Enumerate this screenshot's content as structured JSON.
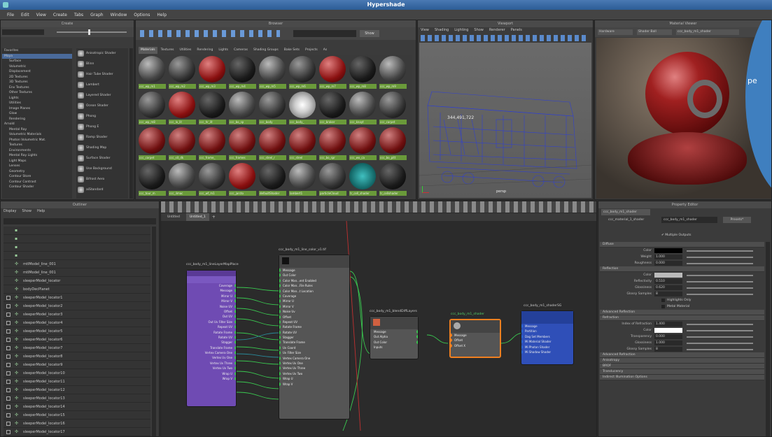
{
  "window": {
    "title": "Hypershade"
  },
  "menu": [
    "File",
    "Edit",
    "View",
    "Create",
    "Tabs",
    "Graph",
    "Window",
    "Options",
    "Help"
  ],
  "browser": {
    "title": "Browser",
    "tabs": [
      "Materials",
      "Textures",
      "Utilities",
      "Rendering",
      "Lights",
      "Cameras",
      "Shading Groups",
      "Bake Sets",
      "Projects",
      "As"
    ],
    "show_button": "Show",
    "swatches": [
      [
        "ccc_wp_m1",
        "ccc_wp_m2",
        "ccc_wp_m3",
        "ccc_wp_m4",
        "ccc_wp_m5",
        "ccc_wp_m6",
        "ccc_wp_m7",
        "ccc_wp_m8",
        "ccc_wp_m9"
      ],
      [
        "ccc_wp_m8",
        "ccc_lo_lit",
        "ccc_hr_lit",
        "ccc_bo_sp",
        "ccc_body",
        "ccc_body_",
        "ccc_braker",
        "ccc_knoyt",
        "ccc_carpet"
      ],
      [
        "ccc_carpet",
        "ccc_sit_dk",
        "ccc_frame_",
        "ccc_frames",
        "ccc_steel_r",
        "ccc_steel",
        "ccc_bo_spr",
        "ccc_wo_ca",
        "ccc_bo_pitt"
      ],
      [
        "ccc_tour_m",
        "ccc_ilmac",
        "ccc_wf_m1",
        "ccc_jarcto",
        "defaultShader",
        "lambert1",
        "particleCloud",
        "tr_cell_shader",
        "tr_cellshader"
      ]
    ]
  },
  "create": {
    "title": "Create",
    "favorites": "Favorites",
    "tree": [
      "Maya",
      "Surface",
      "Volumetric",
      "Displacement",
      "2D Textures",
      "3D Textures",
      "Env Textures",
      "Other Textures",
      "Lights",
      "Utilities",
      "Image Planes",
      "Glow",
      "Rendering",
      "Arnold",
      "Mental Ray",
      "Volumetric Materials",
      "Photon Volumetric Mat.",
      "Textures",
      "Environments",
      "Mental Ray Lights",
      "Light Maps",
      "Lenses",
      "Geometry",
      "Contour Store",
      "Contour Contrast",
      "Contour Shader"
    ],
    "items": [
      "Anisotropic Shader",
      "Blinn",
      "Hair Tube Shader",
      "Lambert",
      "Layered Shader",
      "Ocean Shader",
      "Phong",
      "Phong E",
      "Ramp Shader",
      "Shading Map",
      "Surface Shader",
      "Use Background",
      "Bifrost Aero",
      "aiStandard"
    ]
  },
  "viewport": {
    "title": "Viewport",
    "menu": [
      "View",
      "Shading",
      "Lighting",
      "Show",
      "Renderer",
      "Panels"
    ],
    "label": "persp",
    "readout": "344,491,722"
  },
  "render_view": {
    "title": "Material Viewer",
    "shader_select": "Hardware",
    "ball": "Shader Ball",
    "shader_name": "ccc_body_m1_shader",
    "badge": "pe"
  },
  "outliner": {
    "title": "Outliner",
    "menu": [
      "Display",
      "Show",
      "Help"
    ],
    "items": [
      "",
      "",
      "",
      "",
      "mtlModel_line_001",
      "mtlModel_line_001",
      "sleeperModel_locator",
      "bodyDecPlanet",
      "sleeperModel_locator1",
      "sleeperModel_locator2",
      "sleeperModel_locator3",
      "sleeperModel_locator4",
      "sleeperModel_locator5",
      "sleeperModel_locator6",
      "sleeperModel_locator7",
      "sleeperModel_locator8",
      "sleeperModel_locator9",
      "sleeperModel_locator10",
      "sleeperModel_locator11",
      "sleeperModel_locator12",
      "sleeperModel_locator13",
      "sleeperModel_locator14",
      "sleeperModel_locator15",
      "sleeperModel_locator16",
      "sleeperModel_locator17"
    ]
  },
  "graph": {
    "tabs": [
      "Untitled",
      "Untitled_1"
    ],
    "node_place": {
      "name": "ccc_body_m1_lineLayerMapPlace",
      "rows": [
        "Coverage",
        "Message",
        "Mirror U",
        "Mirror V",
        "Noise UV",
        "Offset",
        "Out UV",
        "Out Uv Filter Size",
        "Repeat UV",
        "Rotate Frame",
        "Rotate UV",
        "Stagger",
        "Translate Frame",
        "Vertex Camera One",
        "Vertex Uv One",
        "Vertex Uv Three",
        "Vertex Uv Two",
        "Wrap U",
        "Wrap V"
      ]
    },
    "node_file": {
      "name": "ccc_body_m1_line_color_v1.tif",
      "rows": [
        "Message",
        "Out Color",
        "Color Man...ent Enabled",
        "Color Man...File Rules",
        "Color Man...t Location",
        "Coverage",
        "Mirror U",
        "Mirror V",
        "Noise Uv",
        "Offset",
        "Repeat UV",
        "Rotate Frame",
        "Rotate UV",
        "Stagger",
        "Translate Frame",
        "Uv Coord",
        "Uv Filter Size",
        "Vertex Camera One",
        "Vertex Uv One",
        "Vertex Uv Three",
        "Vertex Uv Two",
        "Wrap U",
        "Wrap V"
      ]
    },
    "node_blend": {
      "name": "ccc_body_m1_blendDiffLayers",
      "rows": [
        "Message",
        "Out Alpha",
        "Out Color"
      ],
      "input": "Inputs"
    },
    "node_shader": {
      "name": "ccc_body_m1_shader",
      "rows": [
        "Message",
        "Offset",
        "Offset X"
      ]
    },
    "node_sg": {
      "name": "ccc_body_m1_shaderSG",
      "rows": [
        "Message",
        "Partition",
        "Dag Set Members",
        "Mi Material Shader",
        "Mi Photon Shader",
        "Mi Shadow Shader"
      ]
    }
  },
  "attr": {
    "title": "Property Editor",
    "tab": "ccc_body_m1_shader",
    "type": "ccc_material_1_shader",
    "name": "ccc_body_m1_shader",
    "presets": "Presets*",
    "multiple": "Multiple Outputs",
    "diffuse": {
      "header": "Diffuse",
      "rows": [
        {
          "l": "Color",
          "v": ""
        },
        {
          "l": "Weight",
          "v": "1.000"
        },
        {
          "l": "Roughness",
          "v": "0.000"
        }
      ]
    },
    "reflection": {
      "header": "Reflection",
      "rows": [
        {
          "l": "Color",
          "v": ""
        },
        {
          "l": "Reflectivity",
          "v": "0.510"
        },
        {
          "l": "Glossiness",
          "v": "0.620"
        },
        {
          "l": "Glossy Samples",
          "v": "8"
        }
      ],
      "checks": [
        "Highlights Only",
        "Metal Material"
      ]
    },
    "adv_reflection": "Advanced Reflection",
    "refraction": {
      "header": "Refraction",
      "rows": [
        {
          "l": "Index of Refraction",
          "v": "1.400"
        },
        {
          "l": "Color",
          "v": ""
        },
        {
          "l": "Transparency",
          "v": "0.000"
        },
        {
          "l": "Glossiness",
          "v": "1.000"
        },
        {
          "l": "Glossy Samples",
          "v": "8"
        }
      ]
    },
    "collapsed": [
      "Advanced Refraction",
      "Anisotropy",
      "BRDF",
      "Translucency",
      "Indirect Illumination Options"
    ]
  },
  "colors": {
    "accent": "#4a79b3",
    "green": "#6a9a3a",
    "purple": "#6a3fa8",
    "blue": "#2f4fb8",
    "orange": "#f08020",
    "bubble": "#3f7fbf"
  }
}
